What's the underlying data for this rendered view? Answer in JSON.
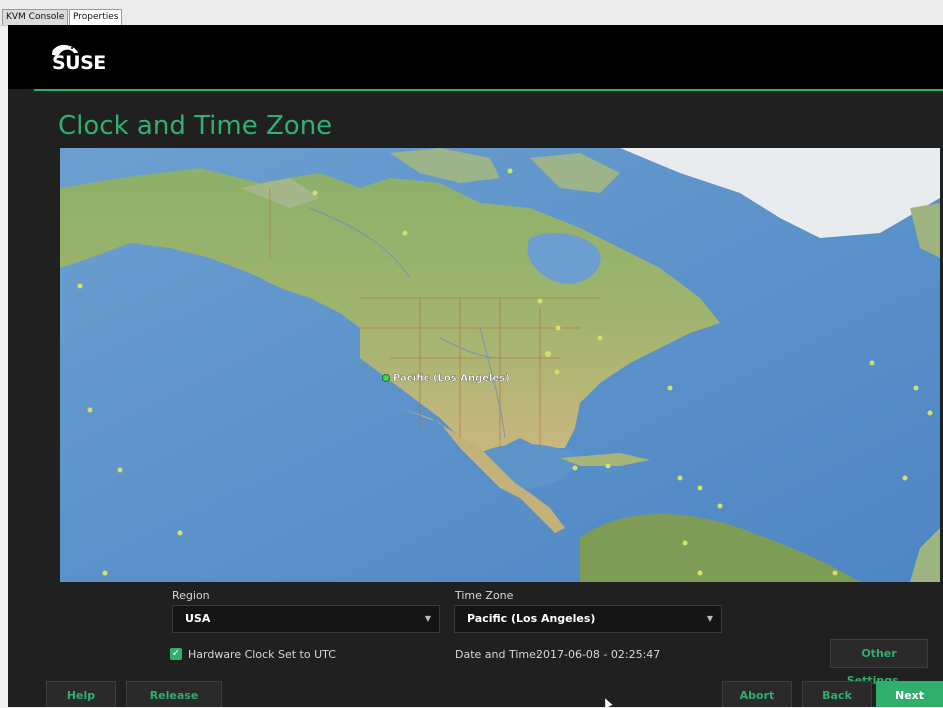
{
  "tabs": [
    "KVM Console",
    "Properties"
  ],
  "brand": {
    "name": "SUSE"
  },
  "page_title": "Clock and Time Zone",
  "map": {
    "selected_city_label": "Pacific (Los Angeles)"
  },
  "region": {
    "label": "Region",
    "value": "USA"
  },
  "timezone": {
    "label": "Time Zone",
    "value": "Pacific (Los Angeles)"
  },
  "hardware_clock": {
    "label": "Hardware Clock Set to UTC",
    "checked": true
  },
  "datetime": {
    "label": "Date and Time:",
    "value": "2017-06-08 - 02:25:47"
  },
  "buttons": {
    "other_settings": "Other Settings...",
    "help": "Help",
    "release_notes": "Release Notes...",
    "abort": "Abort",
    "back": "Back",
    "next": "Next"
  },
  "colors": {
    "accent": "#2fae6c",
    "background": "#202020"
  }
}
